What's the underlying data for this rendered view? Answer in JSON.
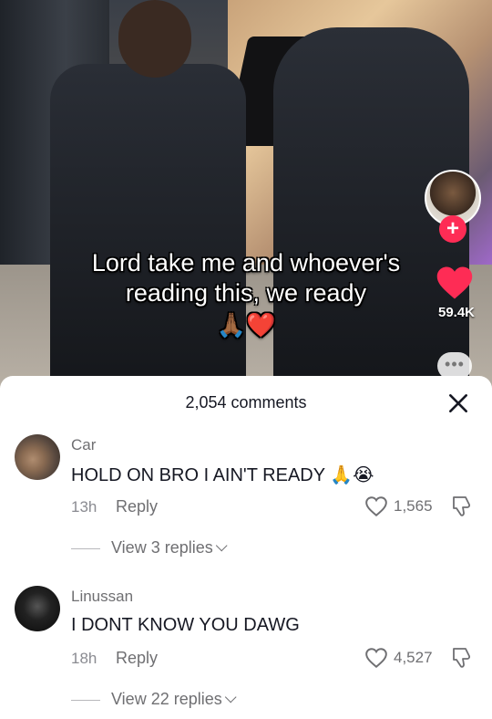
{
  "video": {
    "caption_line1": "Lord take me and whoever's",
    "caption_line2": "reading this, we ready",
    "caption_emoji": "🙏🏾❤️",
    "follow_symbol": "+",
    "like_count": "59.4K",
    "more_label": "•••"
  },
  "sheet": {
    "comment_count": "2,054 comments",
    "close_icon": "close-x-icon"
  },
  "comments": [
    {
      "username": "Car",
      "text": "HOLD ON BRO I AIN'T READY 🙏😭",
      "time": "13h",
      "reply_label": "Reply",
      "likes": "1,565",
      "view_replies": "View 3 replies"
    },
    {
      "username": "Linussan",
      "text": "I DONT KNOW YOU DAWG",
      "time": "18h",
      "reply_label": "Reply",
      "likes": "4,527",
      "view_replies": "View 22 replies"
    }
  ],
  "colors": {
    "accent": "#fe2c55",
    "text_primary": "#161823",
    "text_secondary": "#6f6f72"
  }
}
